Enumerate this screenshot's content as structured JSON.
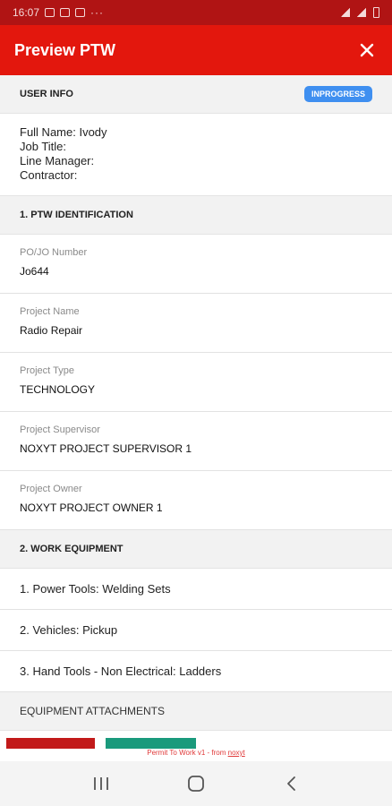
{
  "status_bar": {
    "time": "16:07",
    "dots": "···"
  },
  "app_bar": {
    "title": "Preview PTW"
  },
  "user_info": {
    "heading": "USER INFO",
    "status_badge": "INPROGRESS",
    "lines": [
      "Full Name: Ivody",
      "Job Title:",
      "Line Manager:",
      "Contractor:"
    ]
  },
  "identification": {
    "heading": "1. PTW IDENTIFICATION",
    "fields": [
      {
        "label": "PO/JO Number",
        "value": "Jo644"
      },
      {
        "label": "Project Name",
        "value": "Radio Repair"
      },
      {
        "label": "Project Type",
        "value": "TECHNOLOGY"
      },
      {
        "label": "Project Supervisor",
        "value": "NOXYT PROJECT SUPERVISOR 1"
      },
      {
        "label": "Project Owner",
        "value": "NOXYT PROJECT OWNER 1"
      }
    ]
  },
  "work_equipment": {
    "heading": "2. WORK EQUIPMENT",
    "items": [
      "1. Power Tools: Welding Sets",
      "2. Vehicles: Pickup",
      "3. Hand Tools - Non Electrical: Ladders"
    ]
  },
  "attachments": {
    "heading": "EQUIPMENT ATTACHMENTS"
  },
  "footer": {
    "text": "Permit To Work v1 - from ",
    "link": "noxyt"
  },
  "colors": {
    "status_bar": "#b01414",
    "app_bar": "#e3170d",
    "badge": "#3f8ff0"
  }
}
